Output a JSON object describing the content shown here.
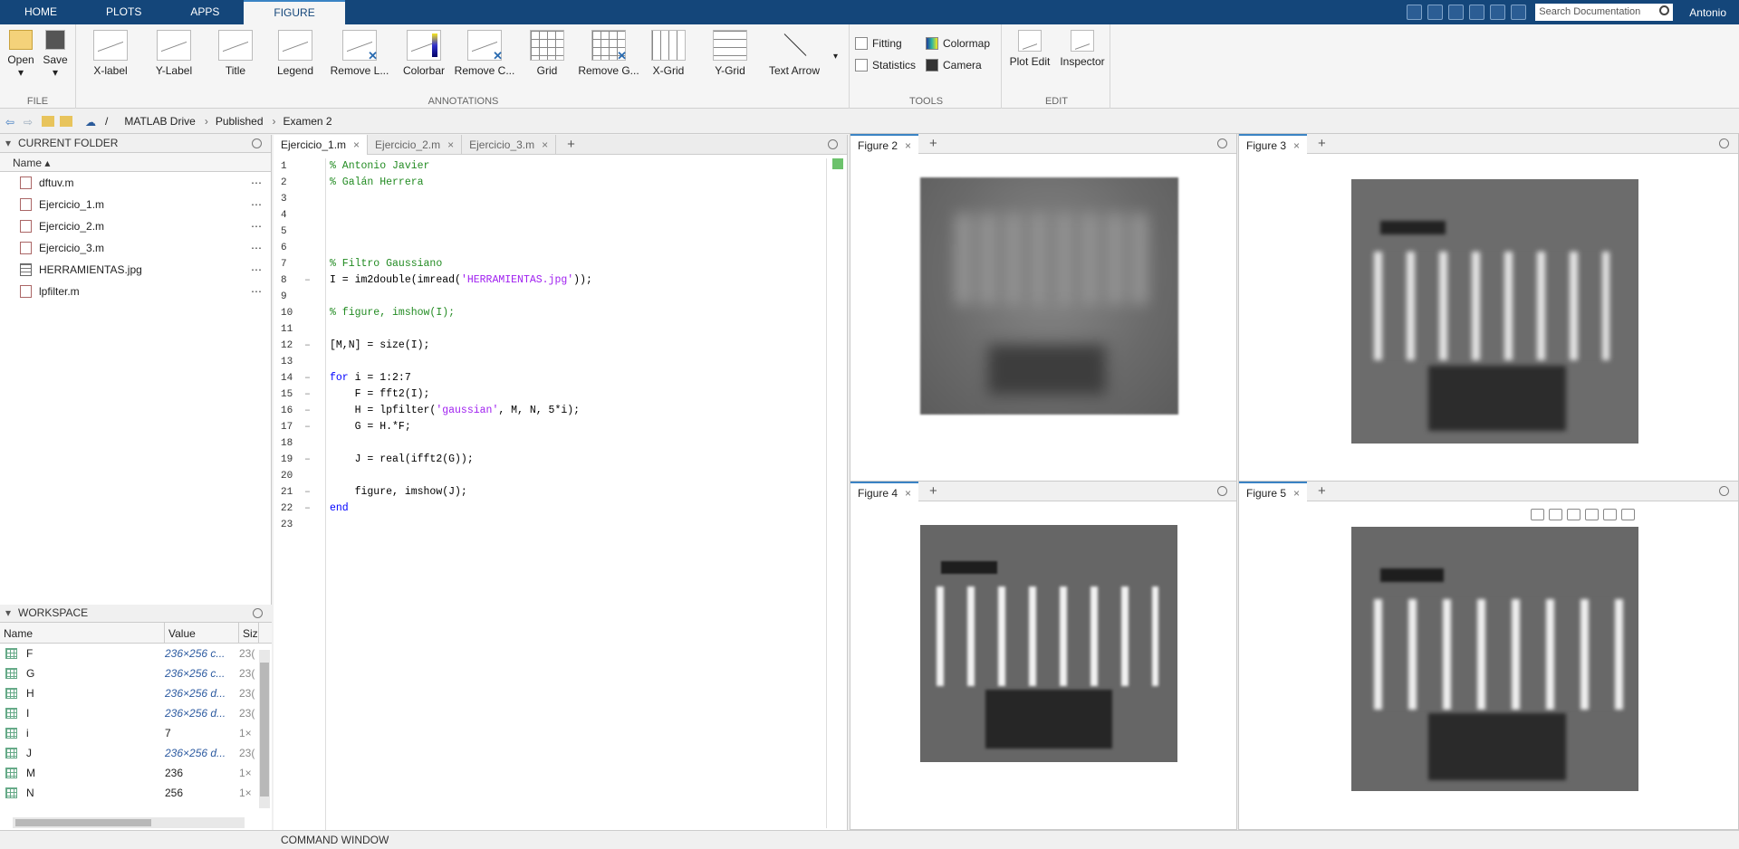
{
  "toptabs": [
    "HOME",
    "PLOTS",
    "APPS",
    "FIGURE"
  ],
  "search": {
    "placeholder": "Search Documentation"
  },
  "user": "Antonio",
  "ribbon": {
    "file": {
      "label": "FILE",
      "open": "Open",
      "save": "Save"
    },
    "annotations": {
      "label": "ANNOTATIONS",
      "items": [
        "X-label",
        "Y-Label",
        "Title",
        "Legend",
        "Remove L...",
        "Colorbar",
        "Remove C...",
        "Grid",
        "Remove G...",
        "X-Grid",
        "Y-Grid",
        "Text Arrow"
      ]
    },
    "tools": {
      "label": "TOOLS",
      "fitting": "Fitting",
      "statistics": "Statistics",
      "colormap": "Colormap",
      "camera": "Camera"
    },
    "edit": {
      "label": "EDIT",
      "plot_edit": "Plot Edit",
      "inspector": "Inspector"
    }
  },
  "address": {
    "root": "/",
    "crumbs": [
      "MATLAB Drive",
      "Published",
      "Examen 2"
    ]
  },
  "current_folder": {
    "title": "CURRENT FOLDER",
    "col_name": "Name",
    "files": [
      "dftuv.m",
      "Ejercicio_1.m",
      "Ejercicio_2.m",
      "Ejercicio_3.m",
      "HERRAMIENTAS.jpg",
      "lpfilter.m"
    ]
  },
  "workspace": {
    "title": "WORKSPACE",
    "cols": [
      "Name",
      "Value",
      "Siz"
    ],
    "rows": [
      {
        "name": "F",
        "value": "236×256 c...",
        "size": "23("
      },
      {
        "name": "G",
        "value": "236×256 c...",
        "size": "23("
      },
      {
        "name": "H",
        "value": "236×256 d...",
        "size": "23("
      },
      {
        "name": "I",
        "value": "236×256 d...",
        "size": "23("
      },
      {
        "name": "i",
        "value": "7",
        "size": "1×"
      },
      {
        "name": "J",
        "value": "236×256 d...",
        "size": "23("
      },
      {
        "name": "M",
        "value": "236",
        "size": "1×"
      },
      {
        "name": "N",
        "value": "256",
        "size": "1×"
      }
    ]
  },
  "editor": {
    "tabs": [
      "Ejercicio_1.m",
      "Ejercicio_2.m",
      "Ejercicio_3.m"
    ],
    "lines": [
      {
        "n": "1",
        "t": "% Antonio Javier",
        "c": "cm"
      },
      {
        "n": "2",
        "t": "% Galán Herrera",
        "c": "cm"
      },
      {
        "n": "3",
        "t": "",
        "c": ""
      },
      {
        "n": "4",
        "t": "",
        "c": ""
      },
      {
        "n": "5",
        "t": "",
        "c": ""
      },
      {
        "n": "6",
        "t": "",
        "c": ""
      },
      {
        "n": "7",
        "t": "% Filtro Gaussiano",
        "c": "cm"
      },
      {
        "n": "8",
        "t": "I = im2double(imread('HERRAMIENTAS.jpg'));",
        "c": ""
      },
      {
        "n": "9",
        "t": "",
        "c": ""
      },
      {
        "n": "10",
        "t": "% figure, imshow(I);",
        "c": "cm"
      },
      {
        "n": "11",
        "t": "",
        "c": ""
      },
      {
        "n": "12",
        "t": "[M,N] = size(I);",
        "c": ""
      },
      {
        "n": "13",
        "t": "",
        "c": ""
      },
      {
        "n": "14",
        "t": "for i = 1:2:7",
        "c": ""
      },
      {
        "n": "15",
        "t": "    F = fft2(I);",
        "c": ""
      },
      {
        "n": "16",
        "t": "    H = lpfilter('gaussian', M, N, 5*i);",
        "c": ""
      },
      {
        "n": "17",
        "t": "    G = H.*F;",
        "c": ""
      },
      {
        "n": "18",
        "t": "",
        "c": ""
      },
      {
        "n": "19",
        "t": "    J = real(ifft2(G));",
        "c": ""
      },
      {
        "n": "20",
        "t": "",
        "c": ""
      },
      {
        "n": "21",
        "t": "    figure, imshow(J);",
        "c": ""
      },
      {
        "n": "22",
        "t": "end",
        "c": "kw"
      },
      {
        "n": "23",
        "t": "",
        "c": ""
      }
    ]
  },
  "figures": [
    "Figure 2",
    "Figure 3",
    "Figure 4",
    "Figure 5"
  ],
  "command_window": "COMMAND WINDOW"
}
